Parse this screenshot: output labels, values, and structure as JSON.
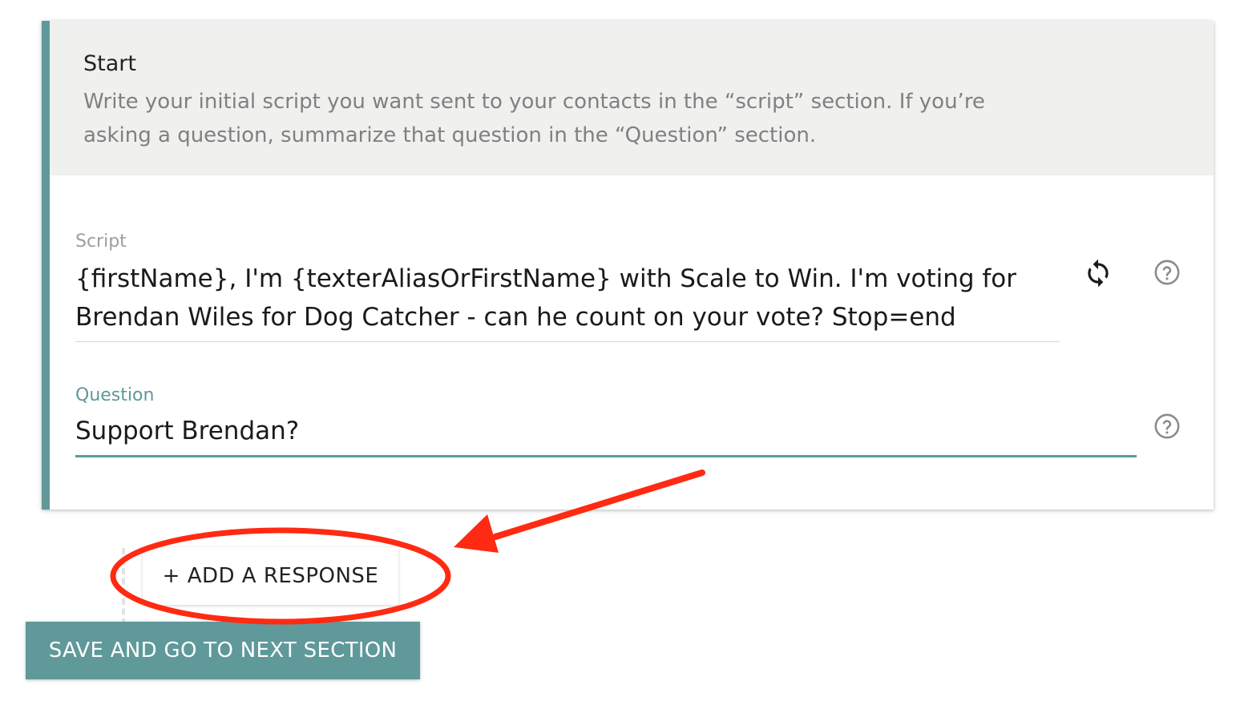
{
  "section": {
    "title": "Start",
    "description": "Write your initial script you want sent to your contacts in the “script” section. If you’re asking a question, summarize that question in the “Question” section."
  },
  "script_field": {
    "label": "Script",
    "value": "{firstName}, I'm {texterAliasOrFirstName} with Scale to Win. I'm voting for Brendan Wiles for Dog Catcher - can he count on your vote? Stop=end",
    "actions": [
      "refresh-icon",
      "help-icon"
    ]
  },
  "question_field": {
    "label": "Question",
    "value": "Support Brendan?",
    "actions": [
      "help-icon"
    ]
  },
  "buttons": {
    "add_response": "+ ADD A RESPONSE",
    "save_next": "SAVE AND GO TO NEXT SECTION"
  },
  "annotation": {
    "shapes": [
      "ellipse",
      "arrow"
    ],
    "color": "#ff2a12"
  },
  "colors": {
    "accent": "#5f999a",
    "header_bg": "#f0f1ef"
  }
}
